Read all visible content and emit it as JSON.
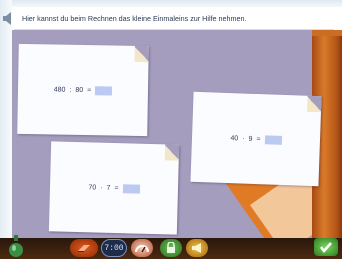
{
  "instruction": {
    "text": "Hier kannst du beim Rechnen das kleine Einmaleins zur Hilfe nehmen."
  },
  "cards": [
    {
      "operand1": "480",
      "operator": ":",
      "operand2": "80",
      "equals": "=",
      "answer": ""
    },
    {
      "operand1": "40",
      "operator": "·",
      "operand2": "9",
      "equals": "=",
      "answer": ""
    },
    {
      "operand1": "70",
      "operator": "·",
      "operand2": "7",
      "equals": "=",
      "answer": ""
    }
  ],
  "toolbar": {
    "clock_display": "7:00",
    "icons": [
      "eraser-icon",
      "clock-icon",
      "gauge-icon",
      "lock-icon",
      "horn-icon",
      "checkmark-icon"
    ]
  },
  "colors": {
    "board": "#a49dbd",
    "answer_box": "#bccaf2",
    "wood": "#d97a2a"
  }
}
